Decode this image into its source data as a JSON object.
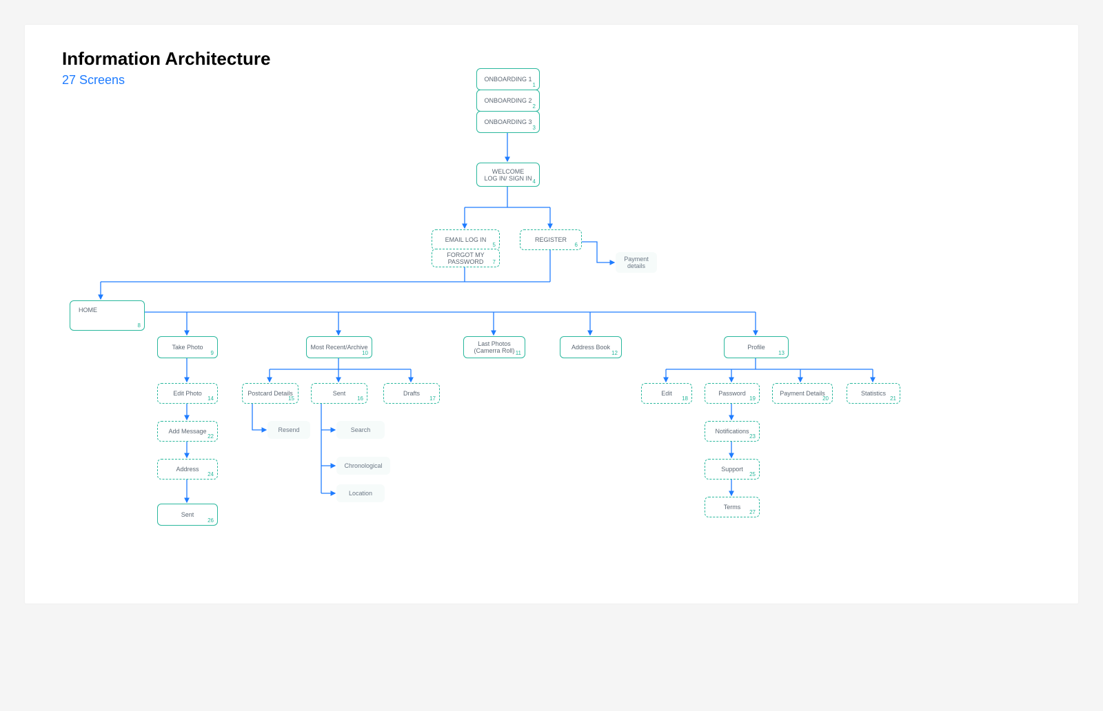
{
  "header": {
    "title": "Information Architecture",
    "subtitle": "27 Screens"
  },
  "nodes": {
    "onboarding1": {
      "label": "ONBOARDING 1",
      "num": "1"
    },
    "onboarding2": {
      "label": "ONBOARDING 2",
      "num": "2"
    },
    "onboarding3": {
      "label": "ONBOARDING 3",
      "num": "3"
    },
    "welcome": {
      "line1": "WELCOME",
      "line2": "LOG IN/ SIGN IN",
      "num": "4"
    },
    "emaillogin": {
      "label": "EMAIL LOG IN",
      "num": "5"
    },
    "register": {
      "label": "REGISTER",
      "num": "6"
    },
    "forgot": {
      "label": "FORGOT MY PASSWORD",
      "num": "7"
    },
    "paymentdetails": {
      "label": "Payment details"
    },
    "home": {
      "label": "HOME",
      "num": "8"
    },
    "takephoto": {
      "label": "Take Photo",
      "num": "9"
    },
    "mostrecent": {
      "label": "Most Recent/Archive",
      "num": "10"
    },
    "lastphotos": {
      "line1": "Last Photos",
      "line2": "(Camerra Roll)",
      "num": "11"
    },
    "addressbook": {
      "label": "Address Book",
      "num": "12"
    },
    "profile": {
      "label": "Profile",
      "num": "13"
    },
    "editphoto": {
      "label": "Edit Photo",
      "num": "14"
    },
    "postcard": {
      "label": "Postcard Details",
      "num": "15"
    },
    "sent1": {
      "label": "Sent",
      "num": "16"
    },
    "drafts": {
      "label": "Drafts",
      "num": "17"
    },
    "edit": {
      "label": "Edit",
      "num": "18"
    },
    "password": {
      "label": "Password",
      "num": "19"
    },
    "paymentdet2": {
      "label": "Payment Details",
      "num": "20"
    },
    "statistics": {
      "label": "Statistics",
      "num": "21"
    },
    "addmessage": {
      "label": "Add Message",
      "num": "22"
    },
    "notifications": {
      "label": "Notifications",
      "num": "23"
    },
    "address": {
      "label": "Address",
      "num": "24"
    },
    "support": {
      "label": "Support",
      "num": "25"
    },
    "sent2": {
      "label": "Sent",
      "num": "26"
    },
    "terms": {
      "label": "Terms",
      "num": "27"
    },
    "resend": {
      "label": "Resend"
    },
    "search": {
      "label": "Search"
    },
    "chronological": {
      "label": "Chronological"
    },
    "location": {
      "label": "Location"
    }
  }
}
